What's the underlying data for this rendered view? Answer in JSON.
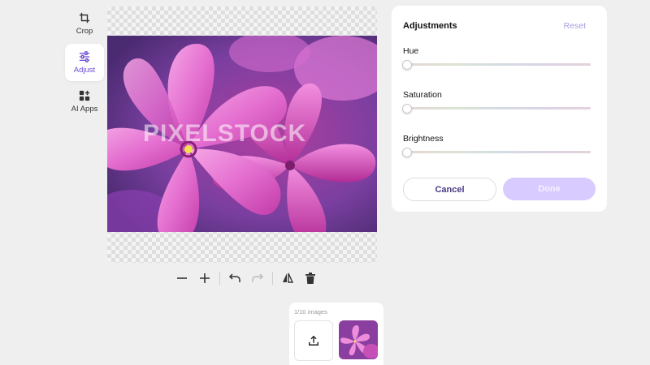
{
  "tools": [
    {
      "label": "Crop",
      "icon": "crop-icon",
      "active": false
    },
    {
      "label": "Adjust",
      "icon": "sliders-icon",
      "active": true
    },
    {
      "label": "AI Apps",
      "icon": "apps-grid-icon",
      "active": false
    }
  ],
  "canvas": {
    "watermark": "PIXELSTOCK"
  },
  "toolbar": {
    "icons": [
      "minus-icon",
      "plus-icon",
      "undo-icon",
      "redo-icon",
      "flip-icon",
      "trash-icon"
    ]
  },
  "adjustments": {
    "title": "Adjustments",
    "reset_label": "Reset",
    "sliders": [
      {
        "label": "Hue",
        "value": 0
      },
      {
        "label": "Saturation",
        "value": 0
      },
      {
        "label": "Brightness",
        "value": 0
      }
    ],
    "cancel_label": "Cancel",
    "done_label": "Done"
  },
  "tray": {
    "count_label": "1/10 images",
    "upload_icon": "upload-icon"
  },
  "colors": {
    "accent": "#6d4bd6",
    "done_button": "#d8cbff",
    "background": "#efefef"
  }
}
